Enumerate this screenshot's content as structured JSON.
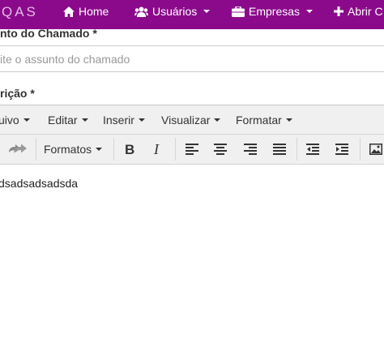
{
  "navbar": {
    "brand": "QAS",
    "items": [
      {
        "label": "Home",
        "icon": "home-icon"
      },
      {
        "label": "Usuários",
        "icon": "users-icon"
      },
      {
        "label": "Empresas",
        "icon": "briefcase-icon"
      },
      {
        "label": "Abrir C",
        "icon": "plus-icon"
      }
    ],
    "background": "#8b0a8b"
  },
  "form": {
    "subject_label": "nto do Chamado *",
    "subject_placeholder": "ite o assunto do chamado",
    "description_label": "rição *"
  },
  "editor": {
    "menu": [
      "uivo",
      "Editar",
      "Inserir",
      "Visualizar",
      "Formatar"
    ],
    "formats_label": "Formatos",
    "content": "dsadsadsadsda"
  }
}
